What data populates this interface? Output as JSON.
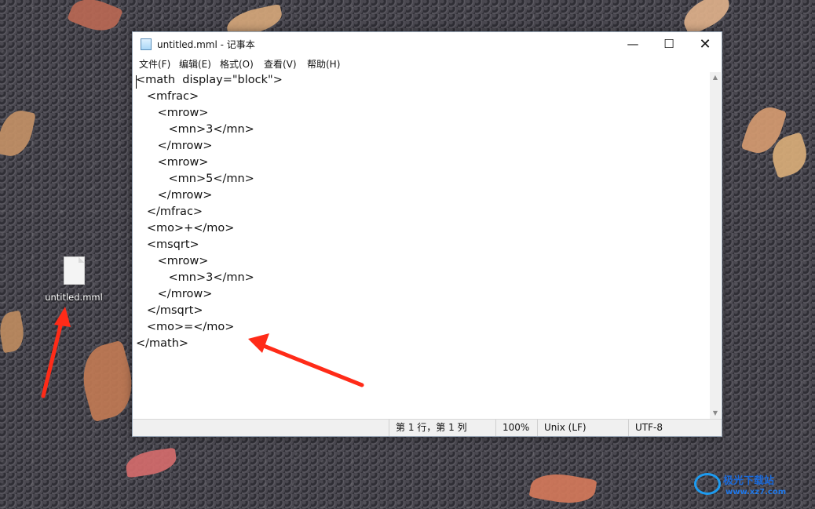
{
  "window": {
    "title": "untitled.mml - 记事本",
    "controls": {
      "minimize": "—",
      "maximize": "☐",
      "close": "✕"
    }
  },
  "menu": {
    "items": [
      "文件(F)",
      "编辑(E)",
      "格式(O)",
      "查看(V)",
      "帮助(H)"
    ]
  },
  "editor": {
    "lines": [
      "<math  display=\"block\">",
      "   <mfrac>",
      "      <mrow>",
      "         <mn>3</mn>",
      "      </mrow>",
      "      <mrow>",
      "         <mn>5</mn>",
      "      </mrow>",
      "   </mfrac>",
      "   <mo>+</mo>",
      "   <msqrt>",
      "      <mrow>",
      "         <mn>3</mn>",
      "      </mrow>",
      "   </msqrt>",
      "   <mo>=</mo>",
      "</math>"
    ]
  },
  "statusbar": {
    "position": "第 1 行，第 1 列",
    "zoom": "100%",
    "line_ending": "Unix (LF)",
    "encoding": "UTF-8"
  },
  "desktop": {
    "file_name": "untitled.mml"
  },
  "annotations": {
    "arrow_color": "#ff2b18"
  },
  "watermark": {
    "brand": "极光下载站",
    "url": "www.xz7.com"
  }
}
